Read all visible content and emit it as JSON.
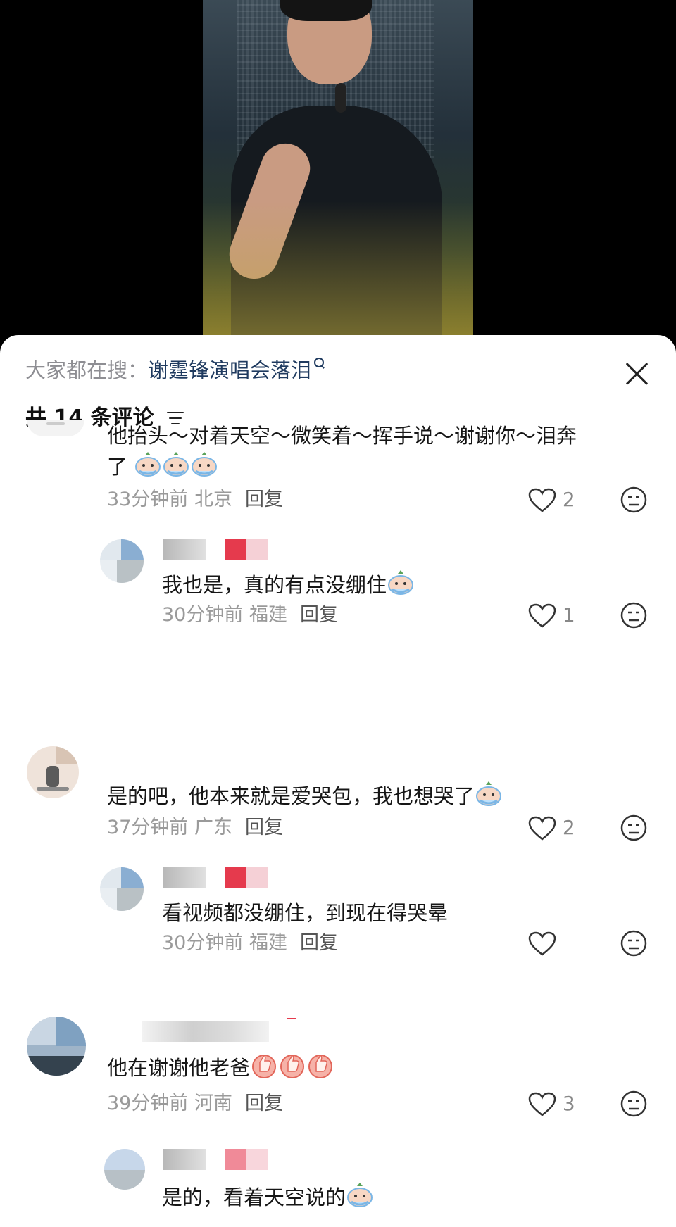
{
  "search": {
    "prefix": "大家都在搜：",
    "term": "谢霆锋演唱会落泪"
  },
  "comments_header": {
    "label": "共 14 条评论"
  },
  "comments": [
    {
      "text": "他抬头～对着天空～微笑着～挥手说～谢谢你～泪奔",
      "text_cont": "了",
      "time": "33分钟前 北京",
      "reply": "回复",
      "likes": "2"
    },
    {
      "text": "我也是，真的有点没绷住",
      "time": "30分钟前 福建",
      "reply": "回复",
      "likes": "1"
    },
    {
      "text": "是的吧，他本来就是爱哭包，我也想哭了",
      "time": "37分钟前 广东",
      "reply": "回复",
      "likes": "2"
    },
    {
      "text": "看视频都没绷住，到现在得哭晕",
      "time": "30分钟前 福建",
      "reply": "回复",
      "likes": ""
    },
    {
      "text": "他在谢谢他老爸",
      "time": "39分钟前 河南",
      "reply": "回复",
      "likes": "3"
    },
    {
      "text": "是的，看着天空说的"
    }
  ],
  "icons": {
    "close": "close-icon",
    "filter": "filter-icon",
    "heart": "heart-icon",
    "dislike": "dislike-face-icon",
    "crying": "crying-emoji",
    "thumbs_up": "thumbs-up-emoji"
  },
  "colors": {
    "search_link": "#1f3a5f",
    "meta": "#9a9a9a"
  }
}
